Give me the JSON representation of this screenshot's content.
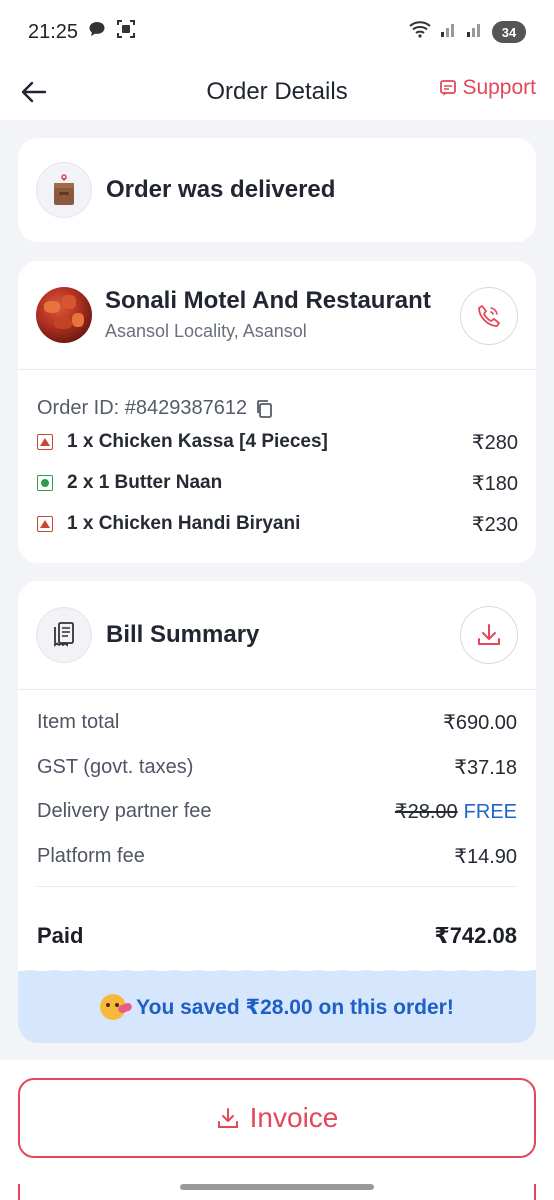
{
  "status_bar": {
    "time": "21:25",
    "battery": "34"
  },
  "header": {
    "title": "Order Details",
    "support_label": "Support"
  },
  "order_status": {
    "text": "Order was delivered"
  },
  "restaurant": {
    "name": "Sonali Motel And Restaurant",
    "location": "Asansol Locality, Asansol"
  },
  "order": {
    "id_label": "Order ID: #8429387612",
    "items": [
      {
        "type": "nonveg",
        "name": "1 x Chicken Kassa [4 Pieces]",
        "price": "₹280"
      },
      {
        "type": "veg",
        "name": "2 x 1 Butter Naan",
        "price": "₹180"
      },
      {
        "type": "nonveg",
        "name": "1 x Chicken Handi Biryani",
        "price": "₹230"
      }
    ]
  },
  "bill": {
    "title": "Bill Summary",
    "rows": [
      {
        "label": "Item total",
        "value": "₹690.00"
      },
      {
        "label": "GST (govt. taxes)",
        "value": "₹37.18"
      },
      {
        "label": "Delivery partner fee",
        "original": "₹28.00",
        "value": "FREE"
      },
      {
        "label": "Platform fee",
        "value": "₹14.90"
      }
    ],
    "paid_label": "Paid",
    "paid_value": "₹742.08",
    "savings_text": "You saved ₹28.00 on this order!"
  },
  "invoice": {
    "label": "Invoice"
  },
  "colors": {
    "accent": "#e2485a",
    "savings_bg": "#d6e6fd",
    "savings_text": "#1e5fc4",
    "veg": "#2f9a4a",
    "nonveg": "#c7482d"
  }
}
